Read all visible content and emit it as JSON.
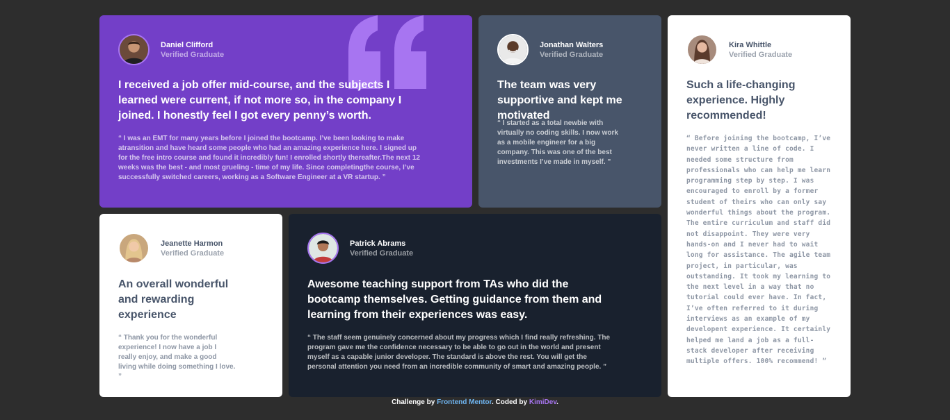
{
  "cards": [
    {
      "name": "Daniel Clifford",
      "role": "Verified Graduate",
      "headline": "I received a job offer mid-course, and the subjects I learned were current, if not more so, in the company I joined. I honestly feel I got every penny’s worth.",
      "body": "“ I was an EMT for many years before I joined the bootcamp. I’ve been looking to make atransition and have heard some people who had an amazing experience here. I signed up for the free intro course and found it incredibly fun! I enrolled shortly thereafter.The next 12 weeks was the best - and most grueling - time of my life. Since completingthe course, I’ve successfully switched careers, working as a Software Engineer at a VR startup. ”"
    },
    {
      "name": "Jonathan Walters",
      "role": "Verified Graduate",
      "headline": "The team was very supportive and kept me motivated",
      "body": "“ I started as a total newbie with virtually no coding skills. I now work as a mobile engineer for a big company. This was one of the best investments I’ve made in myself. ”"
    },
    {
      "name": "Kira Whittle",
      "role": "Verified Graduate",
      "headline": "Such a life-changing experience. Highly recommended!",
      "body": "“ Before joining the bootcamp, I’ve never written a line of code. I needed some structure from professionals who can help me learn programming step by step. I was encouraged to enroll by a former student of theirs who can only say wonderful things about the program. The entire curriculum and staff did not disappoint. They were very hands-on and I never had to wait long for assistance. The agile team project, in particular, was outstanding. It took my learning to the next level in a way that no tutorial could ever have. In fact, I’ve often referred to it during interviews as an example of my developent experience. It certainly helped me land a job as a full-stack developer after receiving multiple offers. 100% recommend! ”"
    },
    {
      "name": "Jeanette Harmon",
      "role": "Verified Graduate",
      "headline": "An overall wonderful and rewarding experience",
      "body": "“ Thank you for the wonderful experience! I now have a job I really enjoy, and make a good living while doing something I love. ”"
    },
    {
      "name": "Patrick Abrams",
      "role": "Verified Graduate",
      "headline": "Awesome teaching support from TAs who did the bootcamp themselves. Getting guidance from them and learning from their experiences was easy.",
      "body": "“ The staff seem genuinely concerned about my progress which I find really refreshing. The program gave me the confidence necessary to be able to go out in the world and present myself as a capable junior developer. The standard is above the rest. You will get the personal attention you need from an incredible community of smart and amazing people. ”"
    }
  ],
  "footer": {
    "prefix": "Challenge by ",
    "challenge_link": "Frontend Mentor",
    "middle": ". Coded by ",
    "author_link": "KimiDev",
    "suffix": "."
  },
  "colors": {
    "page_bg": "#2d2d2d",
    "purple": "#733fc8",
    "gray_blue": "#48556a",
    "dark": "#19212e",
    "white": "#ffffff",
    "quote_mark": "#a775f1"
  },
  "icons": [
    "quotation-mark-icon"
  ]
}
